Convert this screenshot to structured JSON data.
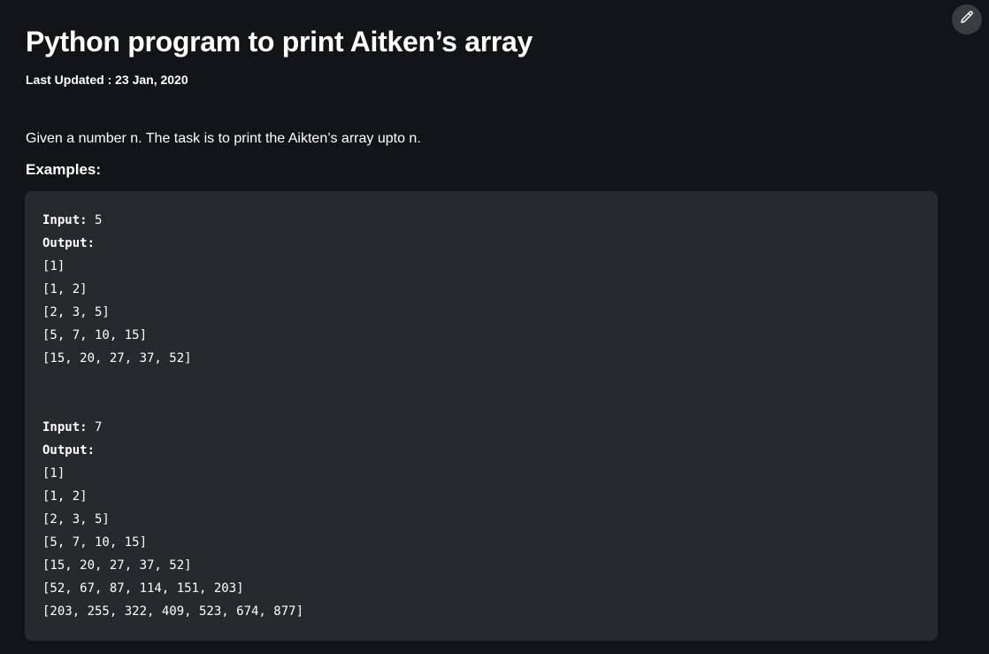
{
  "article": {
    "title": "Python program to print Aitken’s array",
    "last_updated": "Last Updated : 23 Jan, 2020",
    "intro": "Given a number n. The task is to print the Aikten’s array upto n.",
    "examples_heading": "Examples:"
  },
  "edit_button": {
    "icon": "pencil-icon"
  },
  "examples": [
    {
      "input_label": "Input:",
      "input_value": " 5",
      "output_label": "Output:",
      "lines": [
        "[1]",
        "[1, 2]",
        "[2, 3, 5]",
        "[5, 7, 10, 15]",
        "[15, 20, 27, 37, 52]"
      ]
    },
    {
      "input_label": "Input:",
      "input_value": " 7",
      "output_label": "Output:",
      "lines": [
        "[1]",
        "[1, 2]",
        "[2, 3, 5]",
        "[5, 7, 10, 15]",
        "[15, 20, 27, 37, 52]",
        "[52, 67, 87, 114, 151, 203]",
        "[203, 255, 322, 409, 523, 674, 877]"
      ]
    }
  ],
  "colors": {
    "background": "#131417",
    "code_background": "#28292c",
    "edit_button_background": "#3b3c40",
    "text": "#ffffff"
  }
}
